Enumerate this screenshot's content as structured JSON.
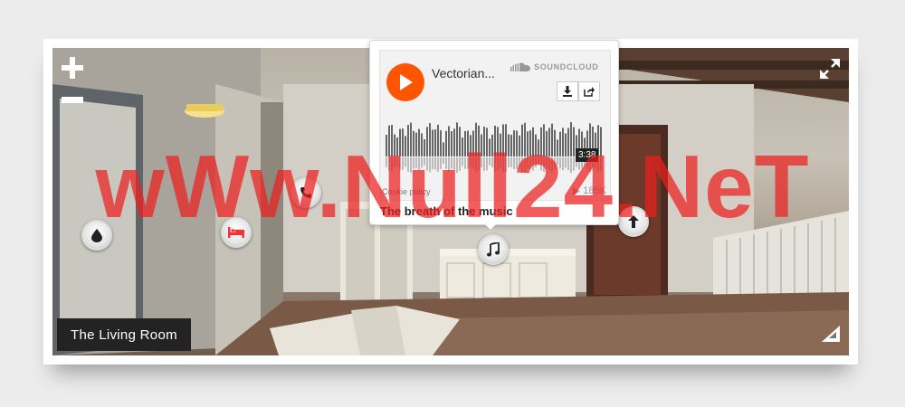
{
  "room": {
    "label": "The Living Room"
  },
  "controls": {
    "zoom_in_icon": "plus-icon",
    "zoom_out_icon": "minus-icon",
    "fullscreen_icon": "expand-icon",
    "gyro_icon": "triangle-icon"
  },
  "hotspots": [
    {
      "name": "hotspot-phone",
      "icon": "phone-icon"
    },
    {
      "name": "hotspot-water",
      "icon": "drop-icon"
    },
    {
      "name": "hotspot-bed",
      "icon": "bed-icon",
      "color": "#e33"
    },
    {
      "name": "hotspot-music",
      "icon": "music-note-icon"
    },
    {
      "name": "hotspot-arrow",
      "icon": "arrow-up-icon"
    }
  ],
  "soundcloud": {
    "title": "Vectorian...",
    "brand": "SOUNDCLOUD",
    "duration": "3:38",
    "cookie_policy": "Cookie policy",
    "plays": "185K",
    "accent": "#ff5500"
  },
  "popup": {
    "song_title": "The breath of the music"
  },
  "watermark": {
    "text": "wWw.Null24.NeT",
    "color": "#ec1e1e"
  }
}
